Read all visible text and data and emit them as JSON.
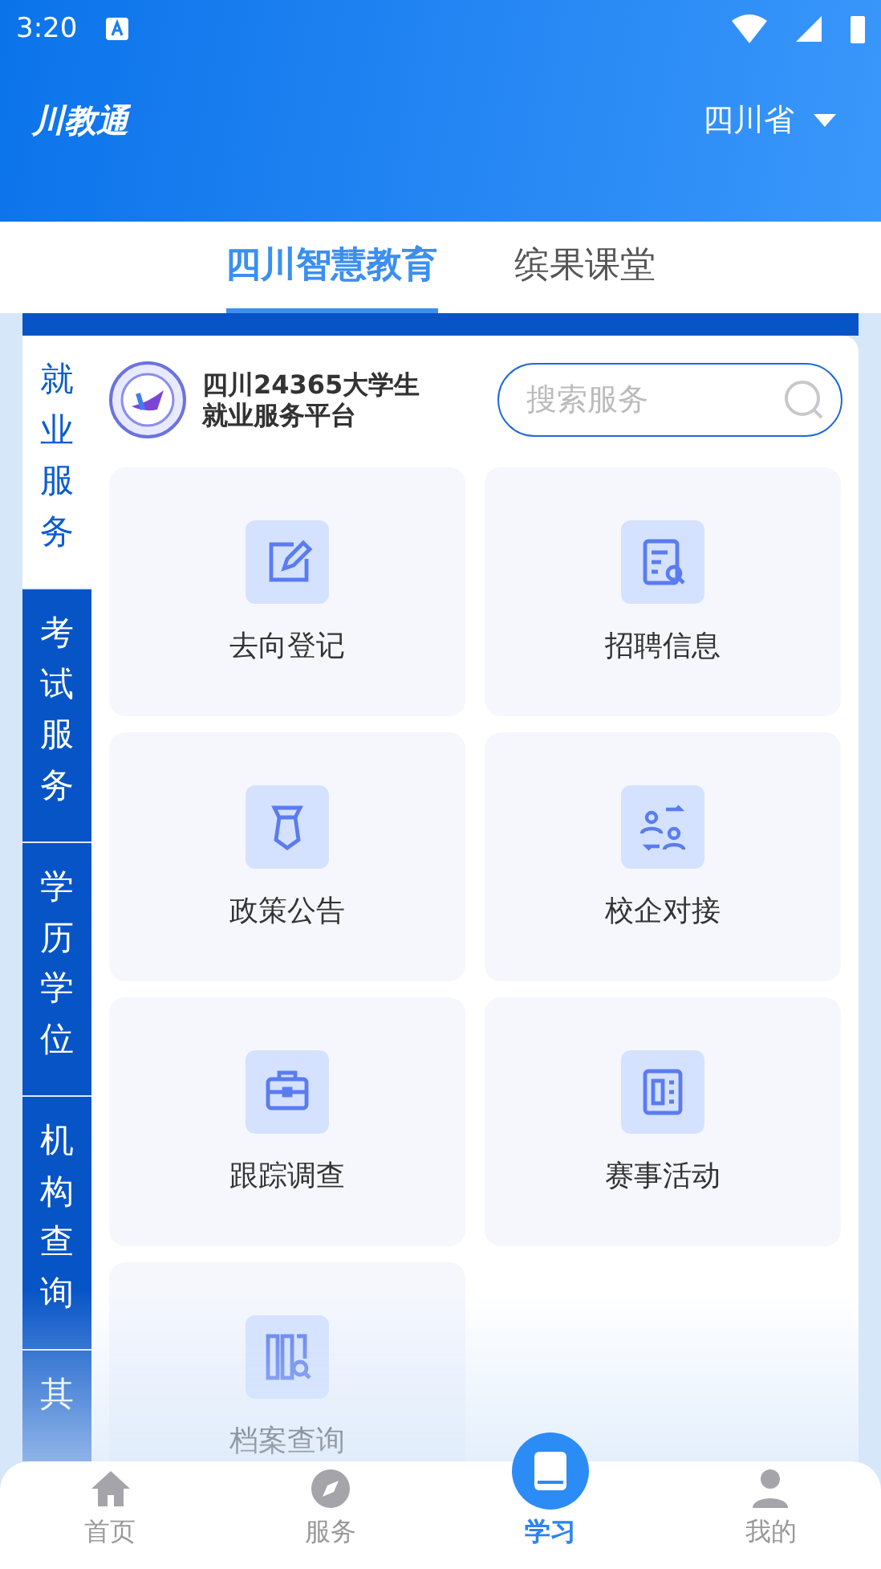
{
  "status_bar": {
    "time": "3:20"
  },
  "header": {
    "logo": "川教通",
    "region": "四川省"
  },
  "tabs": [
    {
      "label": "四川智慧教育",
      "selected": true
    },
    {
      "label": "缤果课堂",
      "selected": false
    }
  ],
  "sidebar": {
    "items": [
      {
        "label": "就业服务",
        "selected": true
      },
      {
        "label": "考试服务",
        "selected": false
      },
      {
        "label": "学历学位",
        "selected": false
      },
      {
        "label": "机构查询",
        "selected": false
      },
      {
        "label": "其",
        "selected": false
      }
    ]
  },
  "platform": {
    "title": "四川24365大学生就业服务平台"
  },
  "search": {
    "placeholder": "搜索服务"
  },
  "services": [
    {
      "label": "去向登记",
      "kind": "edit"
    },
    {
      "label": "招聘信息",
      "kind": "document"
    },
    {
      "label": "政策公告",
      "kind": "tie"
    },
    {
      "label": "校企对接",
      "kind": "exchange"
    },
    {
      "label": "跟踪调查",
      "kind": "briefcase"
    },
    {
      "label": "赛事活动",
      "kind": "board"
    },
    {
      "label": "档案查询",
      "kind": "archive"
    }
  ],
  "bottom_nav": [
    {
      "label": "首页",
      "kind": "home",
      "selected": false
    },
    {
      "label": "服务",
      "kind": "compass",
      "selected": false
    },
    {
      "label": "学习",
      "kind": "book",
      "selected": true
    },
    {
      "label": "我的",
      "kind": "user",
      "selected": false
    }
  ]
}
